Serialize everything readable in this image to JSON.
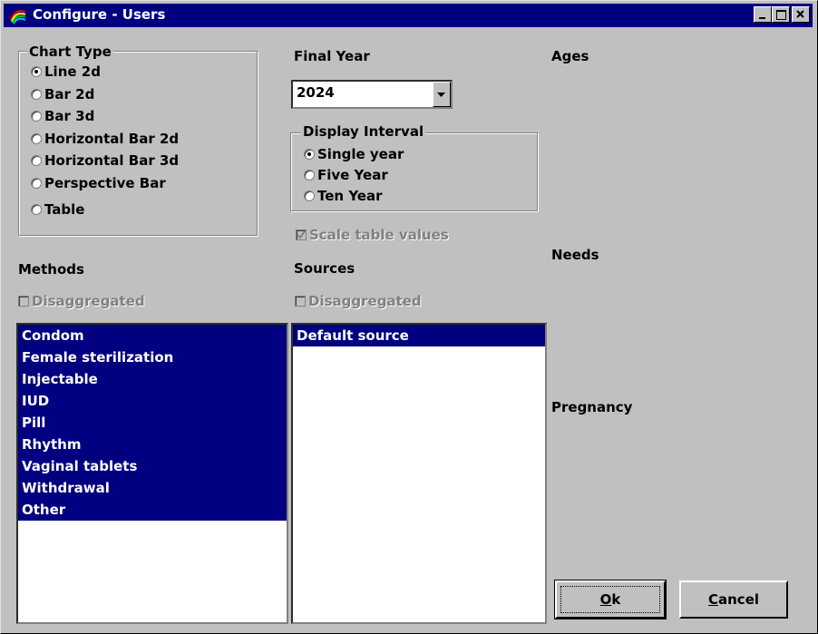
{
  "window": {
    "title": "Configure - Users"
  },
  "chart_type": {
    "legend": "Chart Type",
    "options": [
      {
        "label": "Line 2d",
        "selected": true
      },
      {
        "label": "Bar 2d",
        "selected": false
      },
      {
        "label": "Bar 3d",
        "selected": false
      },
      {
        "label": "Horizontal Bar 2d",
        "selected": false
      },
      {
        "label": "Horizontal Bar 3d",
        "selected": false
      },
      {
        "label": "Perspective Bar",
        "selected": false
      },
      {
        "label": "Table",
        "selected": false
      }
    ]
  },
  "final_year": {
    "label": "Final Year",
    "value": "2024"
  },
  "display_interval": {
    "legend": "Display Interval",
    "options": [
      {
        "label": "Single year",
        "selected": true
      },
      {
        "label": "Five Year",
        "selected": false
      },
      {
        "label": "Ten Year",
        "selected": false
      }
    ]
  },
  "scale_table_values": {
    "label": "Scale table values",
    "checked": true,
    "enabled": false
  },
  "methods": {
    "label": "Methods",
    "disaggregated_label": "Disaggregated",
    "items": [
      "Condom",
      "Female sterilization",
      "Injectable",
      "IUD",
      "Pill",
      "Rhythm",
      "Vaginal tablets",
      "Withdrawal",
      "Other"
    ]
  },
  "sources": {
    "label": "Sources",
    "disaggregated_label": "Disaggregated",
    "items": [
      "Default source"
    ]
  },
  "right_labels": {
    "ages": "Ages",
    "needs": "Needs",
    "pregnancy": "Pregnancy"
  },
  "buttons": {
    "ok_underline": "O",
    "ok_rest": "k",
    "cancel_underline": "C",
    "cancel_rest": "ancel"
  },
  "colors": {
    "titlebar": "#000080",
    "face": "#c0c0c0",
    "selection": "#000080"
  }
}
